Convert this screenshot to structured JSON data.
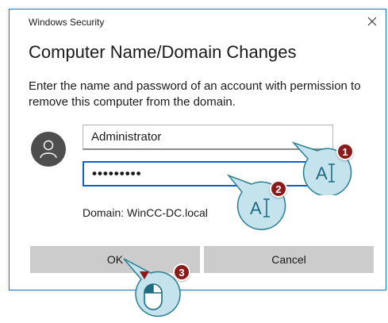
{
  "window": {
    "title": "Windows Security",
    "close_glyph": "×"
  },
  "dialog": {
    "heading": "Computer Name/Domain Changes",
    "description": "Enter the name and password of an account with permission to remove this computer from the domain.",
    "username_value": "Administrator",
    "password_mask": "•••••••••",
    "domain_label": "Domain: WinCC-DC.local",
    "ok_label": "OK",
    "cancel_label": "Cancel"
  },
  "annotations": [
    {
      "number": "1",
      "icon": "text-cursor-icon",
      "glyph": "A"
    },
    {
      "number": "2",
      "icon": "text-cursor-icon",
      "glyph": "A"
    },
    {
      "number": "3",
      "icon": "mouse-left-click-icon"
    }
  ],
  "colors": {
    "accent": "#0d63c7",
    "button_bg": "#cccccc",
    "avatar_bg": "#4e4e4e",
    "badge": "#8b1a1a",
    "callout_fill": "#c4e3ec",
    "callout_stroke": "#2a7e92"
  }
}
